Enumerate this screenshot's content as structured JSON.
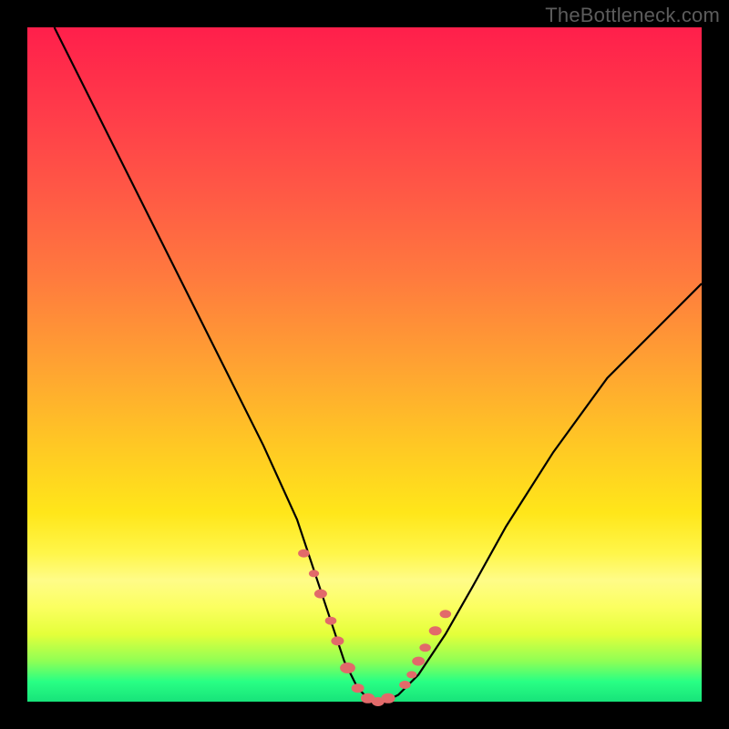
{
  "watermark": "TheBottleneck.com",
  "chart_data": {
    "type": "line",
    "title": "",
    "xlabel": "",
    "ylabel": "",
    "xlim": [
      0,
      100
    ],
    "ylim": [
      0,
      100
    ],
    "grid": false,
    "legend": false,
    "series": [
      {
        "name": "curve",
        "x": [
          4,
          10,
          15,
          20,
          25,
          30,
          35,
          40,
          43,
          45,
          47,
          49,
          51,
          53,
          55,
          58,
          62,
          66,
          71,
          78,
          86,
          94,
          100
        ],
        "y": [
          100,
          88,
          78,
          68,
          58,
          48,
          38,
          27,
          18,
          12,
          6,
          2,
          0,
          0,
          1,
          4,
          10,
          17,
          26,
          37,
          48,
          56,
          62
        ]
      }
    ],
    "points": {
      "name": "valley-dots",
      "color": "#e26a6a",
      "x": [
        41,
        42.5,
        43.5,
        45,
        46,
        47.5,
        49,
        50.5,
        52,
        53.5,
        56,
        57,
        58,
        59,
        60.5,
        62
      ],
      "y": [
        22,
        19,
        16,
        12,
        9,
        5,
        2,
        0.5,
        0,
        0.5,
        2.5,
        4,
        6,
        8,
        10.5,
        13
      ],
      "r": [
        4.5,
        4,
        5,
        4.5,
        5,
        6,
        5,
        5.5,
        5,
        5.5,
        4.5,
        4,
        5,
        4.5,
        5,
        4.5
      ]
    },
    "background_gradient": {
      "orientation": "vertical",
      "stops": [
        {
          "pos": 0.0,
          "color": "#ff1f4b"
        },
        {
          "pos": 0.5,
          "color": "#ffa232"
        },
        {
          "pos": 0.78,
          "color": "#fff64a"
        },
        {
          "pos": 0.94,
          "color": "#8fff55"
        },
        {
          "pos": 1.0,
          "color": "#17e37a"
        }
      ]
    }
  }
}
